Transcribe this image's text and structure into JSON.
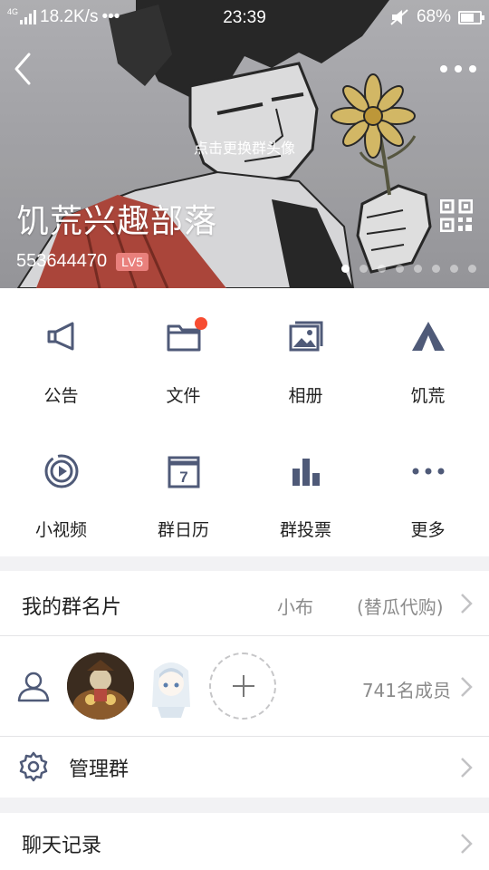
{
  "status_bar": {
    "network": "4G",
    "speed": "18.2K/s",
    "more": "•••",
    "time": "23:39",
    "battery": "68%"
  },
  "header": {
    "change_avatar": "点击更换群头像",
    "group_name": "饥荒兴趣部落",
    "group_id": "553644470",
    "level": "LV5",
    "carousel_pages": 8,
    "carousel_active": 0
  },
  "features": [
    {
      "label": "公告",
      "icon": "megaphone-icon"
    },
    {
      "label": "文件",
      "icon": "folder-icon",
      "badge": true
    },
    {
      "label": "相册",
      "icon": "photo-album-icon"
    },
    {
      "label": "饥荒",
      "icon": "tent-icon"
    },
    {
      "label": "小视频",
      "icon": "video-play-icon"
    },
    {
      "label": "群日历",
      "icon": "calendar-icon",
      "calendar_day": "7"
    },
    {
      "label": "群投票",
      "icon": "bar-chart-icon"
    },
    {
      "label": "更多",
      "icon": "more-dots-icon"
    }
  ],
  "group_card": {
    "title": "我的群名片",
    "nickname": "小布",
    "note": "(替瓜代购)"
  },
  "members": {
    "count_text": "741名成员"
  },
  "manage": {
    "title": "管理群"
  },
  "chat_history": {
    "title": "聊天记录"
  },
  "colors": {
    "icon": "#4f5a78",
    "accent_badge": "#f74c31",
    "level_badge": "#e9807c",
    "secondary_text": "#8b8b8b"
  }
}
